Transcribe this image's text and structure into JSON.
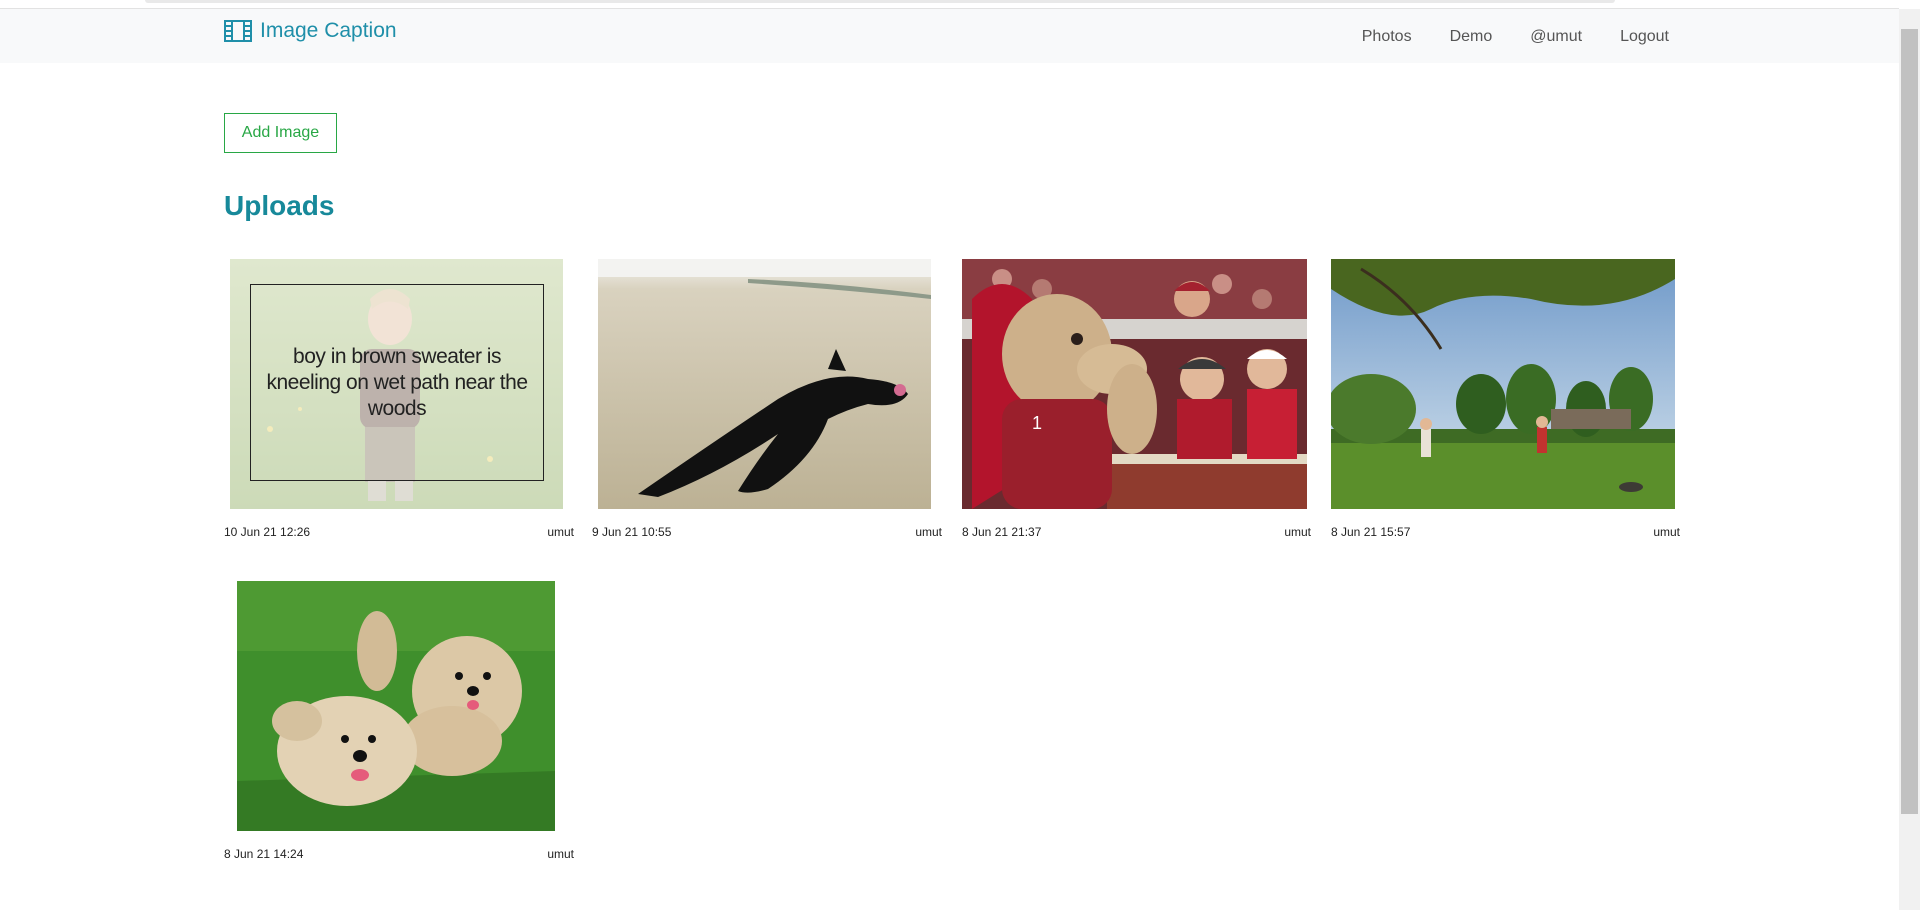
{
  "app": {
    "title": "Image Caption",
    "brand_icon": "film-icon"
  },
  "nav": {
    "links": [
      "Photos",
      "Demo",
      "@umut",
      "Logout"
    ]
  },
  "actions": {
    "add_image_label": "Add Image"
  },
  "uploads": {
    "title": "Uploads",
    "items": [
      {
        "date": "10 Jun 21 12:26",
        "user": "umut",
        "image": "boy-in-field-photo",
        "caption": "boy in brown sweater is kneeling on wet path near the woods"
      },
      {
        "date": "9 Jun 21 10:55",
        "user": "umut",
        "image": "black-dog-running-photo"
      },
      {
        "date": "8 Jun 21 21:37",
        "user": "umut",
        "image": "mascot-with-fans-photo"
      },
      {
        "date": "8 Jun 21 15:57",
        "user": "umut",
        "image": "park-with-people-photo"
      },
      {
        "date": "8 Jun 21 14:24",
        "user": "umut",
        "image": "two-terriers-running-photo"
      }
    ]
  },
  "colors": {
    "brand": "#1f8fa9",
    "section_title": "#17899a",
    "add_button": "#28a745",
    "navbar_bg": "#f8f9fa"
  }
}
